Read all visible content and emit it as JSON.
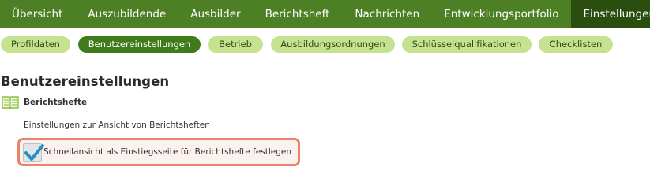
{
  "topnav": {
    "tabs": [
      {
        "label": "Übersicht"
      },
      {
        "label": "Auszubildende"
      },
      {
        "label": "Ausbilder"
      },
      {
        "label": "Berichtsheft"
      },
      {
        "label": "Nachrichten"
      },
      {
        "label": "Entwicklungsportfolio"
      },
      {
        "label": "Einstellungen"
      }
    ],
    "active": "Einstellungen"
  },
  "subnav": {
    "pills": [
      {
        "label": "Profildaten"
      },
      {
        "label": "Benutzereinstellungen"
      },
      {
        "label": "Betrieb"
      },
      {
        "label": "Ausbildungsordnungen"
      },
      {
        "label": "Schlüsselqualifikationen"
      },
      {
        "label": "Checklisten"
      }
    ],
    "active": "Benutzereinstellungen"
  },
  "page": {
    "title": "Benutzereinstellungen"
  },
  "section": {
    "icon": "open-book-icon",
    "title": "Berichtshefte",
    "description": "Einstellungen zur Ansicht von Berichtsheften",
    "option": {
      "label": "Schnellansicht als Einstiegsseite für Berichtshefte festlegen",
      "checked": true
    }
  },
  "colors": {
    "nav_bg": "#4d7f24",
    "nav_active_bg": "#2c4d10",
    "pill_bg": "#c4e28f",
    "pill_active_bg": "#3f7a1b",
    "highlight_border": "#e8836c",
    "checkmark": "#2a8fbf"
  }
}
